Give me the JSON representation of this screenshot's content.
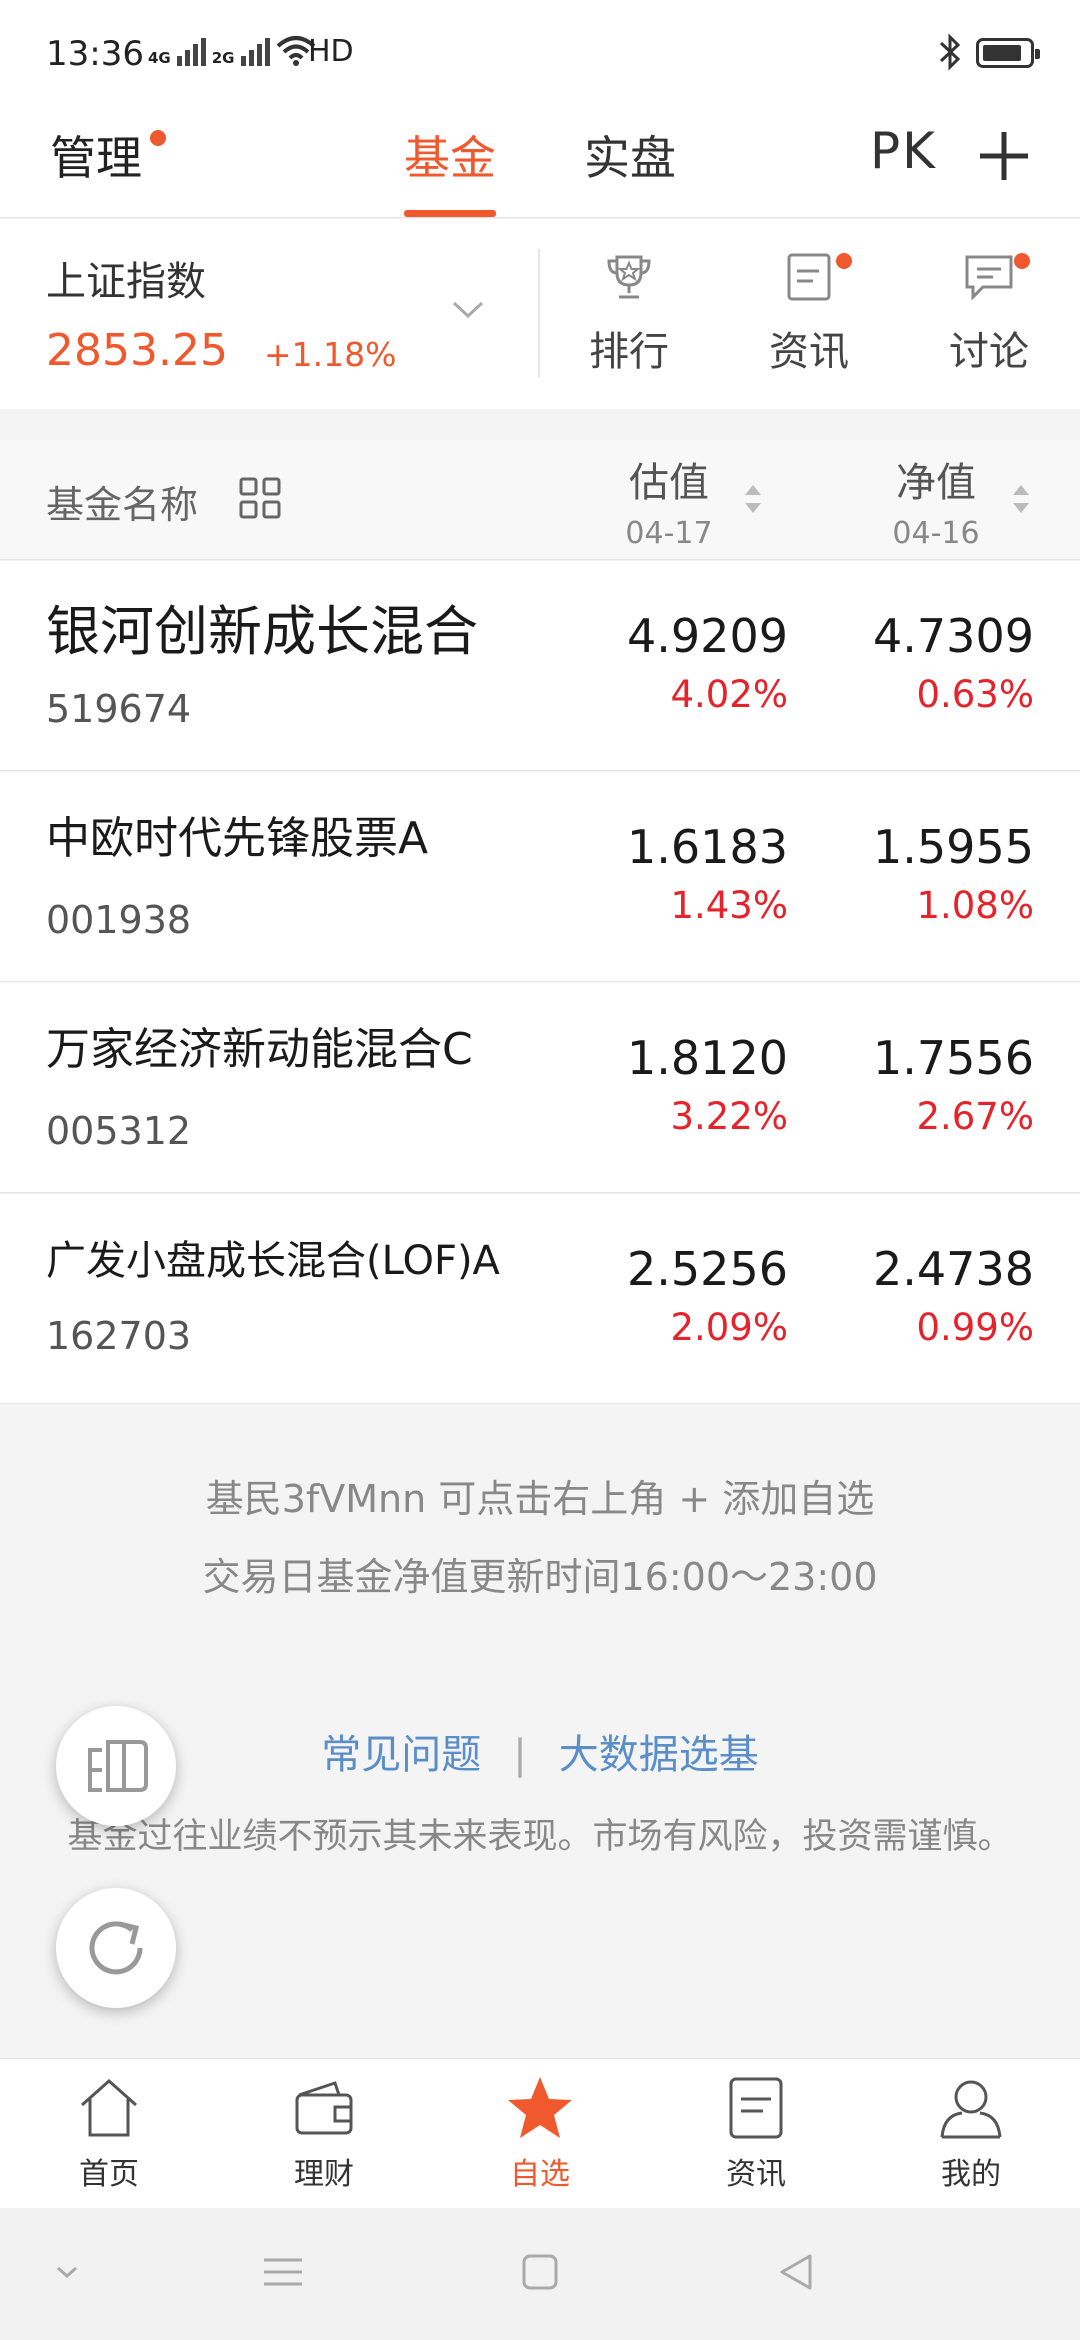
{
  "status_bar": {
    "time": "13:36",
    "net1": "4G",
    "net2": "2G",
    "hd": "HD"
  },
  "top_nav": {
    "manage": "管理",
    "tabs": [
      {
        "label": "基金",
        "active": true
      },
      {
        "label": "实盘",
        "active": false
      }
    ],
    "pk": "PK",
    "accent_color": "#f0582d"
  },
  "index": {
    "name": "上证指数",
    "value": "2853.25",
    "change": "+1.18%"
  },
  "quick_actions": [
    {
      "label": "排行",
      "icon": "trophy-icon",
      "dot": false
    },
    {
      "label": "资讯",
      "icon": "news-icon",
      "dot": true
    },
    {
      "label": "讨论",
      "icon": "chat-icon",
      "dot": true
    }
  ],
  "table": {
    "name_header": "基金名称",
    "estimate_header": "估值",
    "estimate_date": "04-17",
    "nav_header": "净值",
    "nav_date": "04-16"
  },
  "funds": [
    {
      "name": "银河创新成长混合",
      "code": "519674",
      "estimate": "4.9209",
      "estimate_change": "4.02%",
      "nav": "4.7309",
      "nav_change": "0.63%"
    },
    {
      "name": "中欧时代先锋股票A",
      "code": "001938",
      "estimate": "1.6183",
      "estimate_change": "1.43%",
      "nav": "1.5955",
      "nav_change": "1.08%"
    },
    {
      "name": "万家经济新动能混合C",
      "code": "005312",
      "estimate": "1.8120",
      "estimate_change": "3.22%",
      "nav": "1.7556",
      "nav_change": "2.67%"
    },
    {
      "name": "广发小盘成长混合(LOF)A",
      "code": "162703",
      "estimate": "2.5256",
      "estimate_change": "2.09%",
      "nav": "2.4738",
      "nav_change": "0.99%"
    }
  ],
  "info": {
    "line1": "基民3fVMnn 可点击右上角 + 添加自选",
    "line2": "交易日基金净值更新时间16:00～23:00",
    "faq": "常见问题",
    "separator": "|",
    "bigdata": "大数据选基",
    "disclaimer": "基金过往业绩不预示其未来表现。市场有风险，投资需谨慎。"
  },
  "tab_bar": [
    {
      "label": "首页",
      "icon": "home-icon",
      "active": false
    },
    {
      "label": "理财",
      "icon": "wallet-icon",
      "active": false
    },
    {
      "label": "自选",
      "icon": "star-icon",
      "active": true
    },
    {
      "label": "资讯",
      "icon": "document-icon",
      "active": false
    },
    {
      "label": "我的",
      "icon": "profile-icon",
      "active": false
    }
  ],
  "colors": {
    "accent": "#f0582d",
    "rise": "#e5232b",
    "link": "#5a8ec8"
  }
}
